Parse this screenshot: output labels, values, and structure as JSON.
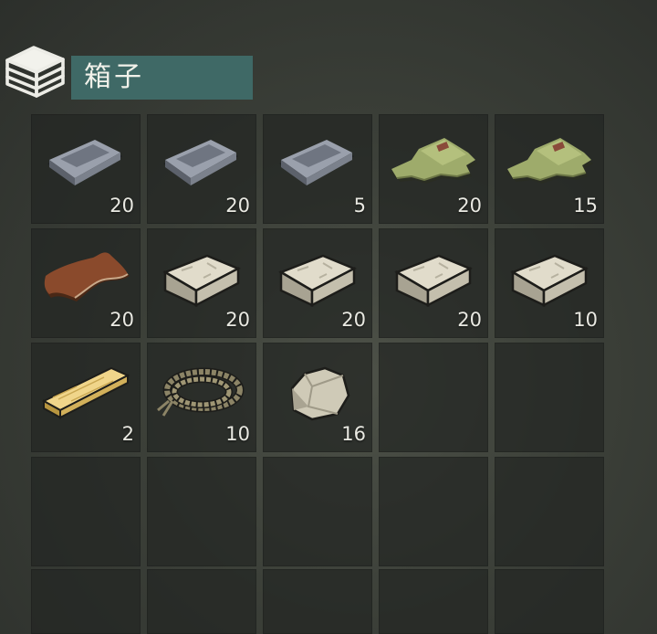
{
  "container": {
    "title": "箱子",
    "icon": "crate-icon",
    "accent": "#3f6966"
  },
  "slots": [
    {
      "item": "iron-ingot-icon",
      "count": "20"
    },
    {
      "item": "iron-ingot-icon",
      "count": "20"
    },
    {
      "item": "iron-ingot-icon",
      "count": "5"
    },
    {
      "item": "cloth-icon",
      "count": "20"
    },
    {
      "item": "cloth-icon",
      "count": "15"
    },
    {
      "item": "leather-icon",
      "count": "20"
    },
    {
      "item": "stone-block-icon",
      "count": "20"
    },
    {
      "item": "stone-block-icon",
      "count": "20"
    },
    {
      "item": "stone-block-icon",
      "count": "20"
    },
    {
      "item": "stone-block-icon",
      "count": "10"
    },
    {
      "item": "wood-plank-icon",
      "count": "2"
    },
    {
      "item": "rope-icon",
      "count": "10"
    },
    {
      "item": "stone-icon",
      "count": "16"
    },
    {
      "item": "",
      "count": ""
    },
    {
      "item": "",
      "count": ""
    },
    {
      "item": "",
      "count": ""
    },
    {
      "item": "",
      "count": ""
    },
    {
      "item": "",
      "count": ""
    },
    {
      "item": "",
      "count": ""
    },
    {
      "item": "",
      "count": ""
    },
    {
      "item": "",
      "count": ""
    },
    {
      "item": "",
      "count": ""
    },
    {
      "item": "",
      "count": ""
    },
    {
      "item": "",
      "count": ""
    },
    {
      "item": "",
      "count": ""
    }
  ]
}
